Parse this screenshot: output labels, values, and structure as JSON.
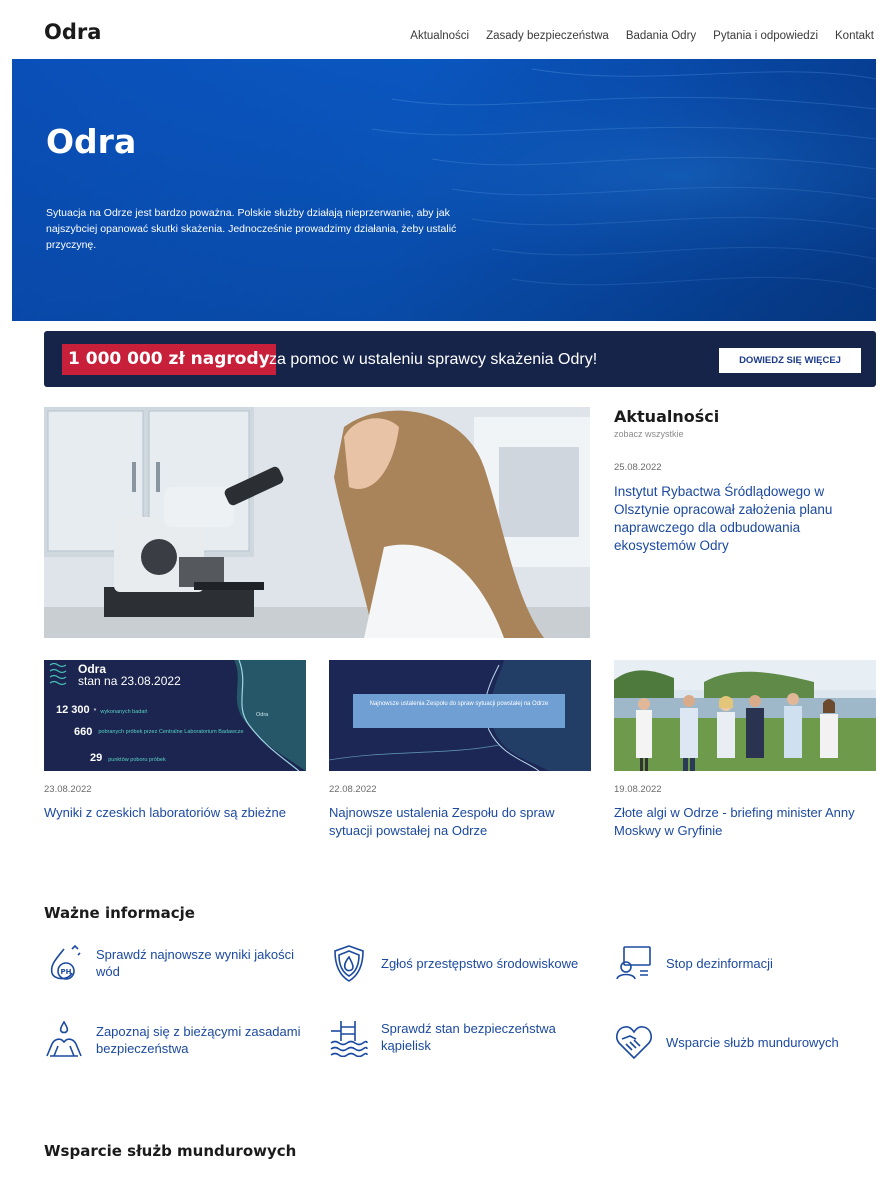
{
  "header": {
    "logo": "Odra",
    "nav": [
      "Aktualności",
      "Zasady bezpieczeństwa",
      "Badania Odry",
      "Pytania i odpowiedzi",
      "Kontakt"
    ]
  },
  "hero": {
    "title": "Odra",
    "text": "Sytuacja na Odrze jest bardzo poważna. Polskie służby działają nieprzerwanie, aby jak najszybciej opanować skutki skażenia. Jednocześnie prowadzimy działania, żeby ustalić przyczynę."
  },
  "reward": {
    "amount": "1 000 000 zł nagrody",
    "text": "za pomoc w ustaleniu sprawcy skażenia Odry!",
    "button": "DOWIEDZ SIĘ WIĘCEJ"
  },
  "news": {
    "heading": "Aktualności",
    "see_all": "zobacz wszystkie",
    "featured": {
      "date": "25.08.2022",
      "title": "Instytut Rybactwa Śródlądowego w Olsztynie opracował założenia planu naprawczego dla odbudowania ekosystemów Odry"
    },
    "cards": [
      {
        "date": "23.08.2022",
        "title": "Wyniki z czeskich laboratoriów są zbieżne",
        "thumb": {
          "brand": "Odra",
          "subtitle": "stan na 23.08.2022",
          "stats": [
            {
              "num": "12 300",
              "sup": "*",
              "label": "wykonanych badań"
            },
            {
              "num": "660",
              "sup": "",
              "label": "pobranych próbek przez Centralne Laboratorium Badawcze"
            },
            {
              "num": "29",
              "sup": "",
              "label": "punktów poboru próbek"
            }
          ],
          "map_label": "Odra"
        }
      },
      {
        "date": "22.08.2022",
        "title": "Najnowsze ustalenia Zespołu do spraw sytuacji powstałej na Odrze",
        "thumb": {
          "caption": "Najnowsze ustalenia Zespołu do spraw sytuacji powstałej na Odrze"
        }
      },
      {
        "date": "19.08.2022",
        "title": "Złote algi w Odrze - briefing minister Anny Moskwy w Gryfinie"
      }
    ]
  },
  "important": {
    "heading": "Ważne informacje",
    "items": [
      {
        "label": "Sprawdź najnowsze wyniki jakości wód",
        "icon": "water-quality-ph-icon",
        "icon_text": "PH"
      },
      {
        "label": "Zgłoś przestępstwo środowiskowe",
        "icon": "shield-icon"
      },
      {
        "label": "Stop dezinformacji",
        "icon": "computer-user-icon"
      },
      {
        "label": "Zapoznaj się z bieżącymi zasadami bezpieczeństwa",
        "icon": "hands-water-icon"
      },
      {
        "label": "Sprawdź stan bezpieczeństwa kąpielisk",
        "icon": "pool-ladder-icon"
      },
      {
        "label": "Wsparcie służb mundurowych",
        "icon": "heart-handshake-icon"
      }
    ]
  },
  "support": {
    "heading": "Wsparcie służb mundurowych"
  },
  "colors": {
    "link": "#1c4aa0",
    "hero_blue": "#0b5cc9",
    "banner_navy": "#16244a",
    "reward_red": "#c8203a"
  }
}
